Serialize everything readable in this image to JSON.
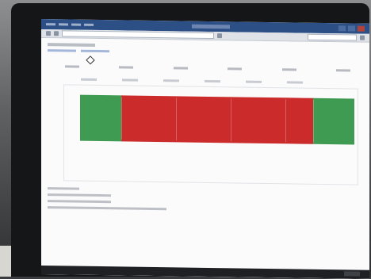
{
  "window": {
    "title": "",
    "menu": [],
    "address": "",
    "search_placeholder": ""
  },
  "page": {
    "heading": "",
    "links": [],
    "parameters": []
  },
  "timeline": {
    "segments": [
      {
        "label": "",
        "color": "#3f9a52",
        "share": 0.15
      },
      {
        "label": "",
        "color": "#cb2b2b",
        "share": 0.2
      },
      {
        "label": "",
        "color": "#cb2b2b",
        "share": 0.2
      },
      {
        "label": "",
        "color": "#cb2b2b",
        "share": 0.2
      },
      {
        "label": "",
        "color": "#cb2b2b",
        "share": 0.1
      },
      {
        "label": "",
        "color": "#3f9a52",
        "share": 0.15
      }
    ]
  },
  "details": {
    "lines": []
  },
  "colors": {
    "window_title_bar": "#2c4f86",
    "link": "#5c7fc0",
    "status_good": "#3f9a52",
    "status_bad": "#cb2b2b"
  }
}
